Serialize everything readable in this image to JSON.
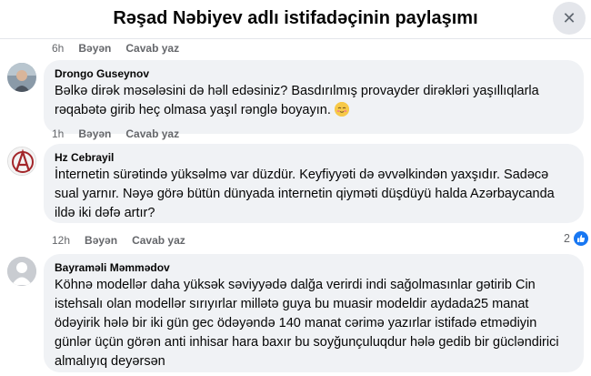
{
  "header": {
    "title": "Rəşad Nəbiyev adlı istifadəçinin paylaşımı",
    "close_glyph": "✕"
  },
  "comments": [
    {
      "time": "6h",
      "like_label": "Bəyən",
      "reply_label": "Cavab yaz"
    },
    {
      "author": "Drongo Guseynov",
      "text": "Bəlkə dirək məsələsini də həll edəsiniz? Basdırılmış provayder dirəkləri yaşıllıqlarla rəqabətə girib heç olmasa yaşıl rənglə boyayın.",
      "time": "1h",
      "like_label": "Bəyən",
      "reply_label": "Cavab yaz",
      "emoji": "smiling-face-emoji"
    },
    {
      "author": "Hz Cebrayil",
      "text": "İnternetin sürətində yüksəlmə var düzdür. Keyfiyyəti də əvvəlkindən yaxşıdır. Sadəcə sual yarnır. Nəyə görə bütün dünyada internetin qiyməti düşdüyü halda Azərbaycanda ildə iki dəfə artır?",
      "time": "12h",
      "like_label": "Bəyən",
      "reply_label": "Cavab yaz",
      "reaction_count": "2"
    },
    {
      "author": "Bayraməli Məmmədov",
      "text": "Köhnə modellər daha yüksək səviyyədə dalğa verirdi indi sağolmasınlar gətirib Cin istehsalı olan modellər sırıyırlar millətə guya bu muasir modeldir aydada25 manat ödəyirik hələ bir iki gün gec ödəyəndə 140 manat cərimə yazırlar istifadə etmədiyin günlər üçün görən anti inhisar hara baxır bu soyğunçuluqdur hələ gedib bir gücləndirici almalıyıq deyərsən"
    }
  ],
  "colors": {
    "bubble": "#f0f2f5",
    "meta_text": "#65676b",
    "like_blue": "#1877f2"
  }
}
